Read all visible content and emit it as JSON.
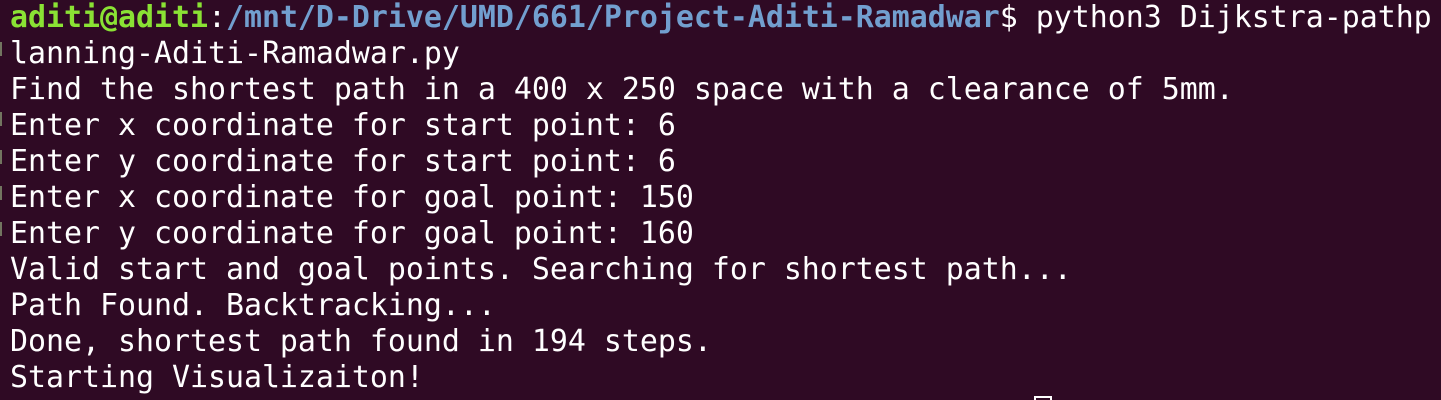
{
  "prompt": {
    "user_host": "aditi@aditi",
    "colon": ":",
    "path": "/mnt/D-Drive/UMD/661/Project-Aditi-Ramadwar",
    "dollar": "$",
    "command": " python3 Dijkstra-pathp"
  },
  "output_lines": [
    "lanning-Aditi-Ramadwar.py",
    "Find the shortest path in a 400 x 250 space with a clearance of 5mm.",
    "Enter x coordinate for start point: 6",
    "Enter y coordinate for start point: 6",
    "Enter x coordinate for goal point: 150",
    "Enter y coordinate for goal point: 160",
    "Valid start and goal points. Searching for shortest path...",
    "Path Found. Backtracking...",
    "Done, shortest path found in 194 steps.",
    "Starting Visualizaiton!"
  ],
  "colors": {
    "background": "#2f0a24",
    "prompt_user": "#8ae234",
    "prompt_path": "#729fcf",
    "text": "#ffffff"
  }
}
